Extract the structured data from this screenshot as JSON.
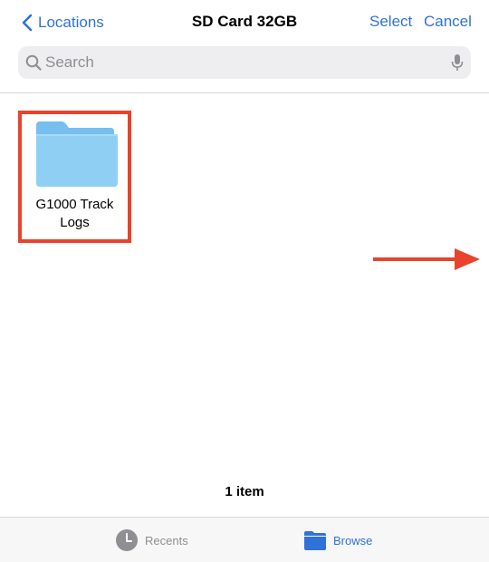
{
  "nav": {
    "back_label": "Locations",
    "title": "SD Card 32GB",
    "select_label": "Select",
    "cancel_label": "Cancel"
  },
  "search": {
    "placeholder": "Search",
    "value": ""
  },
  "folders": [
    {
      "name": "G1000 Track Logs",
      "icon": "folder-icon",
      "highlighted": true
    }
  ],
  "footer": {
    "item_count": "1 item"
  },
  "tabs": [
    {
      "label": "Recents",
      "icon": "clock-icon",
      "selected": false
    },
    {
      "label": "Browse",
      "icon": "folder-icon",
      "selected": true
    }
  ],
  "colors": {
    "accent": "#2f72d8",
    "annotation": "#e8432c",
    "folder": "#8fcff4",
    "inactive": "#8e8e93"
  }
}
